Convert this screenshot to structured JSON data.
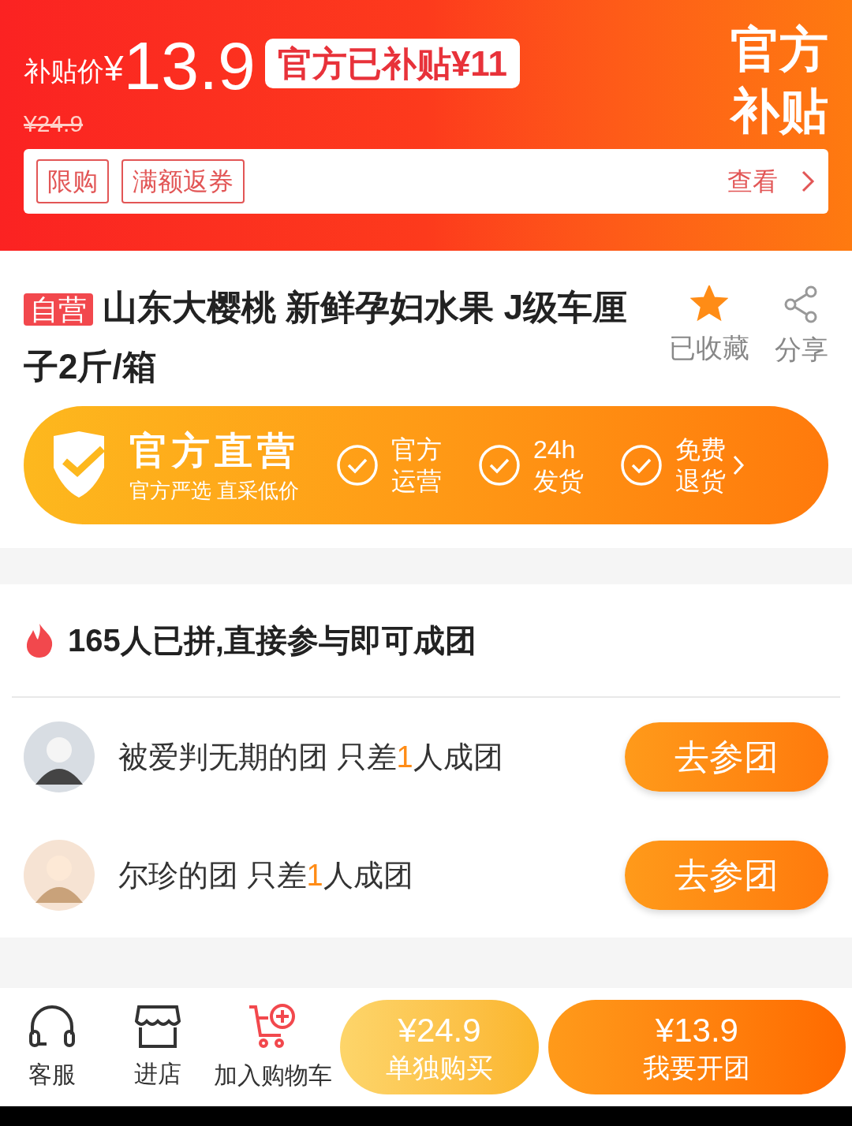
{
  "subsidy_banner": {
    "price_label": "补贴价",
    "currency": "¥",
    "price": "13.9",
    "subsidy_badge": "官方已补贴¥11",
    "original_price": "¥24.9",
    "corner_title": [
      "官方",
      "补贴"
    ],
    "tags": [
      "限购",
      "满额返券"
    ],
    "view_link": "查看"
  },
  "product": {
    "self_operated_tag": "自营",
    "title": "山东大樱桃 新鲜孕妇水果 J级车厘子2斤/箱",
    "favorite": {
      "label": "已收藏",
      "on": true
    },
    "share": {
      "label": "分享"
    }
  },
  "guarantee": {
    "title": "官方直营",
    "subtitle": "官方严选 直采低价",
    "items": [
      [
        "官方",
        "运营"
      ],
      [
        "24h",
        "发货"
      ],
      [
        "免费",
        "退货"
      ]
    ]
  },
  "group_buy": {
    "headline": "165人已拼,直接参与即可成团",
    "groups": [
      {
        "team": "被爱判无期的团",
        "need_before": "只差",
        "need_count": "1",
        "need_after": "人成团",
        "button": "去参团"
      },
      {
        "team": "尔珍的团",
        "need_before": "只差",
        "need_count": "1",
        "need_after": "人成团",
        "button": "去参团"
      }
    ]
  },
  "bottom_bar": {
    "actions": [
      {
        "kind": "headset",
        "label": "客服"
      },
      {
        "kind": "store",
        "label": "进店"
      },
      {
        "kind": "cart",
        "label": "加入购物车"
      }
    ],
    "solo_buy": {
      "price": "¥24.9",
      "label": "单独购买"
    },
    "group_open": {
      "price": "¥13.9",
      "label": "我要开团"
    }
  }
}
